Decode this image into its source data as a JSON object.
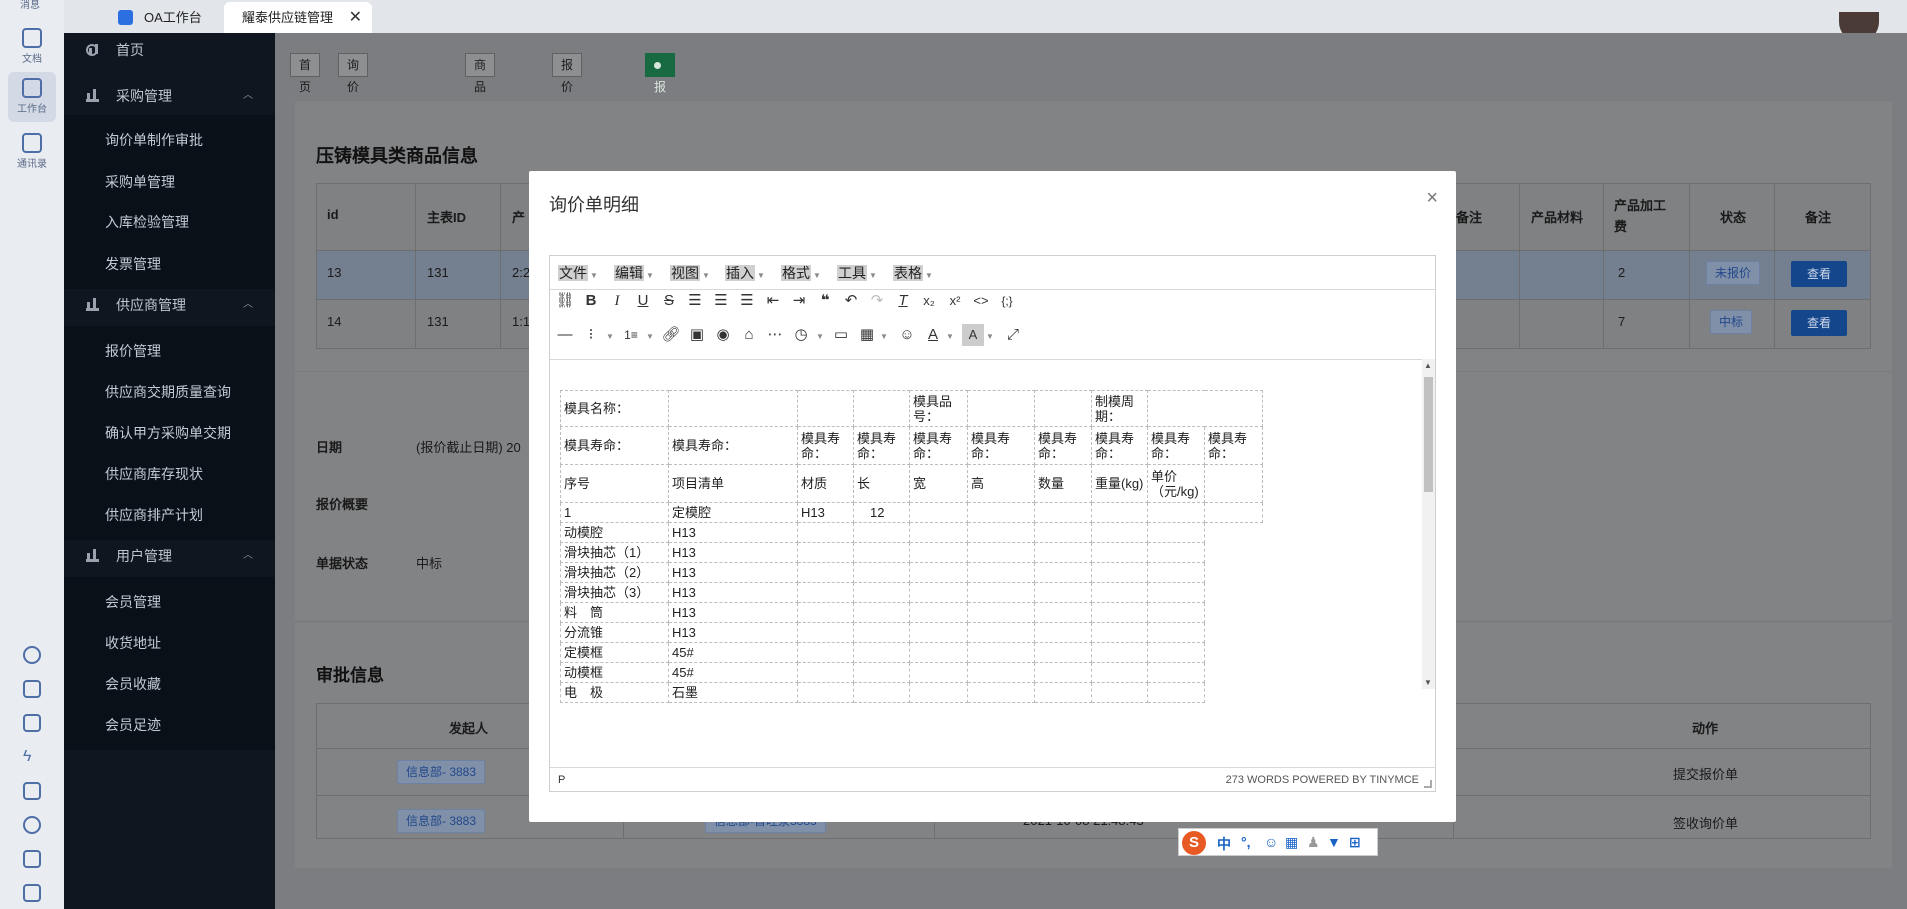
{
  "rail": {
    "top_fragment": "消息",
    "items": [
      {
        "label": "文档",
        "icon": "document-icon"
      },
      {
        "label": "工作台",
        "icon": "workbench-icon"
      },
      {
        "label": "通讯录",
        "icon": "contacts-icon"
      }
    ],
    "bottom_icons": [
      "cloud-icon",
      "calendar-icon",
      "task-icon",
      "flash-icon",
      "mail-icon",
      "phone-icon",
      "note-icon",
      "folder-icon"
    ]
  },
  "window_tabs": [
    {
      "label": "OA工作台"
    },
    {
      "label": "耀泰供应链管理",
      "close": "✕"
    }
  ],
  "sidebar": {
    "home": "首页",
    "groups": [
      {
        "label": "采购管理",
        "items": [
          "询价单制作审批",
          "采购单管理",
          "入库检验管理",
          "发票管理"
        ]
      },
      {
        "label": "供应商管理",
        "items": [
          "报价管理",
          "供应商交期质量查询",
          "确认甲方采购单交期",
          "供应商库存现状",
          "供应商排产计划"
        ]
      },
      {
        "label": "用户管理",
        "items": [
          "会员管理",
          "收货地址",
          "会员收藏",
          "会员足迹"
        ]
      }
    ]
  },
  "nav_tabs": [
    {
      "label": "首页"
    },
    {
      "label": "询价单制作审批",
      "close": "×"
    },
    {
      "label": "商品浏览",
      "close": "×"
    },
    {
      "label": "报价管理",
      "close": "×"
    },
    {
      "label": "报价单审批",
      "close": "×"
    }
  ],
  "product_panel": {
    "title": "压铸模具类商品信息",
    "headers_left": [
      "id",
      "主表ID",
      "产"
    ],
    "headers_right": [
      "备注",
      "产品材料",
      "产品加工费",
      "状态",
      "备注"
    ],
    "rows": [
      {
        "id": "13",
        "main_id": "131",
        "prod": "2:2",
        "fee": "2",
        "status": "未报价",
        "action": "查看"
      },
      {
        "id": "14",
        "main_id": "131",
        "prod": "1:1",
        "fee": "7",
        "status": "中标",
        "action": "查看"
      }
    ]
  },
  "info_panel": {
    "date_label": "日期",
    "date_value": "(报价截止日期) 20",
    "summary_label": "报价概要",
    "status_label": "单据状态",
    "status_value": "中标"
  },
  "approval_panel": {
    "title": "审批信息",
    "col_initiator": "发起人",
    "col_action": "动作",
    "rows": [
      {
        "initiator": "信息部- 3883",
        "action": "提交报价单"
      },
      {
        "initiator": "信息部- 3883",
        "middle": "信息部-首旺泉3883",
        "time": "2021-10-08 21:48:43",
        "action": "签收询价单"
      }
    ]
  },
  "modal": {
    "title": "询价单明细",
    "close": "×",
    "menus": [
      "文件",
      "编辑",
      "视图",
      "插入",
      "格式",
      "工具",
      "表格"
    ],
    "status_path": "P",
    "status_words": "273 WORDS POWERED BY TINYMCE",
    "doc": {
      "row1": [
        "模具名称：",
        "",
        "",
        "",
        "模具品号：",
        "",
        "",
        "制模周期："
      ],
      "row2": [
        "模具寿命：",
        "模具寿命：",
        "模具寿命：",
        "模具寿命：",
        "模具寿命：",
        "模具寿命：",
        "模具寿命：",
        "模具寿命：",
        "模具寿命：",
        "模具寿命："
      ],
      "header": [
        "序号",
        "项目清单",
        "材质",
        "长",
        "宽",
        "高",
        "数量",
        "重量(kg)",
        "单价（元/kg)"
      ],
      "first": [
        "1",
        "定模腔",
        "H13",
        "12"
      ],
      "items": [
        [
          "动模腔",
          "H13"
        ],
        [
          "滑块抽芯（1）",
          "H13"
        ],
        [
          "滑块抽芯（2）",
          "H13"
        ],
        [
          "滑块抽芯（3）",
          "H13"
        ],
        [
          "料　筒",
          "H13"
        ],
        [
          "分流锥",
          "H13"
        ],
        [
          "定模框",
          "45#"
        ],
        [
          "动模框",
          "45#"
        ],
        [
          "电　极",
          "石墨"
        ]
      ]
    }
  },
  "ime": {
    "mode": "中",
    "punct": "°,"
  }
}
